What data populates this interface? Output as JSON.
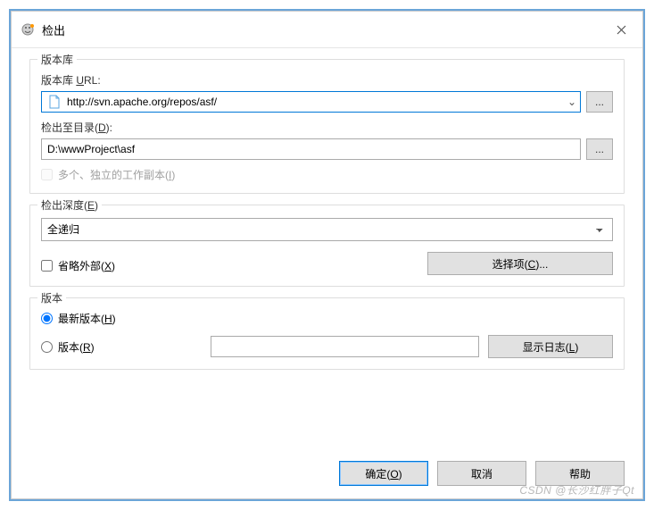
{
  "title": "检出",
  "repository": {
    "group_title": "版本库",
    "url_label": "版本库 URL:",
    "url_value": "http://svn.apache.org/repos/asf/",
    "dir_label": "检出至目录(D):",
    "dir_value": "D:\\wwwProject\\asf",
    "multi_label": "多个、独立的工作副本(I)",
    "browse_label": "..."
  },
  "depth": {
    "group_title": "检出深度(E)",
    "selected": "全递归",
    "omit_label": "省略外部(X)",
    "choose_btn": "选择项(C)..."
  },
  "revision": {
    "group_title": "版本",
    "head_label": "最新版本(H)",
    "rev_label": "版本(R)",
    "rev_value": "",
    "showlog_btn": "显示日志(L)"
  },
  "buttons": {
    "ok": "确定(O)",
    "cancel": "取消",
    "help": "帮助"
  },
  "watermark": "CSDN @长沙红胖子Qt"
}
